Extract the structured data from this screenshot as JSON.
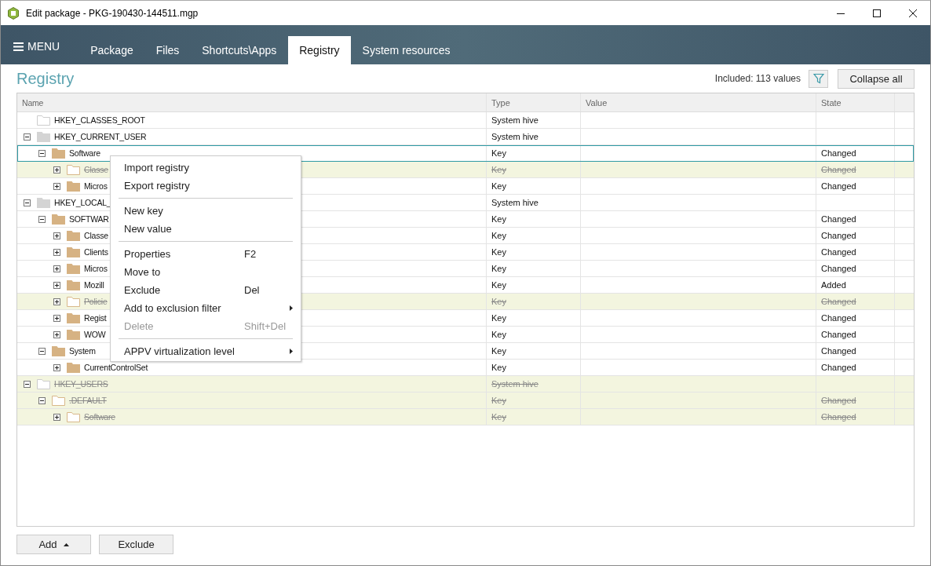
{
  "window": {
    "title": "Edit package - PKG-190430-144511.mgp"
  },
  "menu_button": {
    "label": "MENU"
  },
  "tabs": [
    {
      "label": "Package",
      "selected": false
    },
    {
      "label": "Files",
      "selected": false
    },
    {
      "label": "Shortcuts\\Apps",
      "selected": false
    },
    {
      "label": "Registry",
      "selected": true
    },
    {
      "label": "System resources",
      "selected": false
    }
  ],
  "heading": "Registry",
  "summary": "Included: 113 values",
  "collapse_button": "Collapse all",
  "table": {
    "columns": [
      "Name",
      "Type",
      "Value",
      "State"
    ],
    "rows": [
      {
        "name": "HKEY_CLASSES_ROOT",
        "type": "System hive",
        "kind": "empty",
        "excluded": false,
        "selected": false
      },
      {
        "name": "HKEY_CURRENT_USER",
        "type": "System hive",
        "kind": "hive",
        "expanded": true,
        "excluded": false,
        "selected": false,
        "children": [
          {
            "name": "Software",
            "type": "Key",
            "state": "Changed",
            "kind": "key",
            "expanded": true,
            "excluded": false,
            "selected": true,
            "children": [
              {
                "name": "Classe",
                "type": "Key",
                "state": "Changed",
                "kind": "key",
                "expanded": false,
                "excluded": true,
                "selected": false
              },
              {
                "name": "Micros",
                "type": "Key",
                "state": "Changed",
                "kind": "key",
                "expanded": false,
                "excluded": false,
                "selected": false
              }
            ]
          }
        ]
      },
      {
        "name": "HKEY_LOCAL_",
        "type": "System hive",
        "kind": "hive",
        "expanded": true,
        "excluded": false,
        "selected": false,
        "children": [
          {
            "name": "SOFTWAR",
            "type": "Key",
            "state": "Changed",
            "kind": "key",
            "expanded": true,
            "excluded": false,
            "selected": false,
            "children": [
              {
                "name": "Classe",
                "type": "Key",
                "state": "Changed",
                "kind": "key",
                "expanded": false,
                "excluded": false,
                "selected": false
              },
              {
                "name": "Clients",
                "type": "Key",
                "state": "Changed",
                "kind": "key",
                "expanded": false,
                "excluded": false,
                "selected": false
              },
              {
                "name": "Micros",
                "type": "Key",
                "state": "Changed",
                "kind": "key",
                "expanded": false,
                "excluded": false,
                "selected": false
              },
              {
                "name": "Mozill",
                "type": "Key",
                "state": "Added",
                "kind": "key",
                "expanded": false,
                "excluded": false,
                "selected": false
              },
              {
                "name": "Policie",
                "type": "Key",
                "state": "Changed",
                "kind": "key",
                "expanded": false,
                "excluded": true,
                "selected": false
              },
              {
                "name": "Regist",
                "type": "Key",
                "state": "Changed",
                "kind": "key",
                "expanded": false,
                "excluded": false,
                "selected": false
              },
              {
                "name": "WOW",
                "type": "Key",
                "state": "Changed",
                "kind": "key",
                "expanded": false,
                "excluded": false,
                "selected": false
              }
            ]
          },
          {
            "name": "System",
            "type": "Key",
            "state": "Changed",
            "kind": "key",
            "expanded": true,
            "excluded": false,
            "selected": false,
            "children": [
              {
                "name": "CurrentControlSet",
                "type": "Key",
                "state": "Changed",
                "kind": "key",
                "expanded": false,
                "excluded": false,
                "selected": false
              }
            ]
          }
        ]
      },
      {
        "name": "HKEY_USERS",
        "type": "System hive",
        "kind": "hive",
        "expanded": true,
        "excluded": true,
        "selected": false,
        "children": [
          {
            "name": ".DEFAULT",
            "type": "Key",
            "state": "Changed",
            "kind": "key",
            "expanded": true,
            "excluded": true,
            "selected": false,
            "children": [
              {
                "name": "Software",
                "type": "Key",
                "state": "Changed",
                "kind": "key",
                "expanded": false,
                "excluded": true,
                "selected": false
              }
            ]
          }
        ]
      }
    ]
  },
  "context_menu": [
    {
      "kind": "item",
      "label": "Import registry",
      "submenu": false,
      "disabled": false
    },
    {
      "kind": "item",
      "label": "Export registry",
      "submenu": false,
      "disabled": false
    },
    {
      "kind": "separator"
    },
    {
      "kind": "item",
      "label": "New key",
      "submenu": false,
      "disabled": false
    },
    {
      "kind": "item",
      "label": "New value",
      "submenu": false,
      "disabled": false
    },
    {
      "kind": "separator"
    },
    {
      "kind": "item",
      "label": "Properties",
      "shortcut": "F2",
      "submenu": false,
      "disabled": false
    },
    {
      "kind": "item",
      "label": "Move to",
      "submenu": false,
      "disabled": false
    },
    {
      "kind": "item",
      "label": "Exclude",
      "shortcut": "Del",
      "submenu": false,
      "disabled": false
    },
    {
      "kind": "item",
      "label": "Add to exclusion filter",
      "submenu": true,
      "disabled": false
    },
    {
      "kind": "item",
      "label": "Delete",
      "shortcut": "Shift+Del",
      "submenu": false,
      "disabled": true
    },
    {
      "kind": "separator"
    },
    {
      "kind": "item",
      "label": "APPV virtualization level",
      "submenu": true,
      "disabled": false
    }
  ],
  "footer_buttons": [
    {
      "label": "Add",
      "dropdown": true
    },
    {
      "label": "Exclude",
      "dropdown": false
    }
  ]
}
